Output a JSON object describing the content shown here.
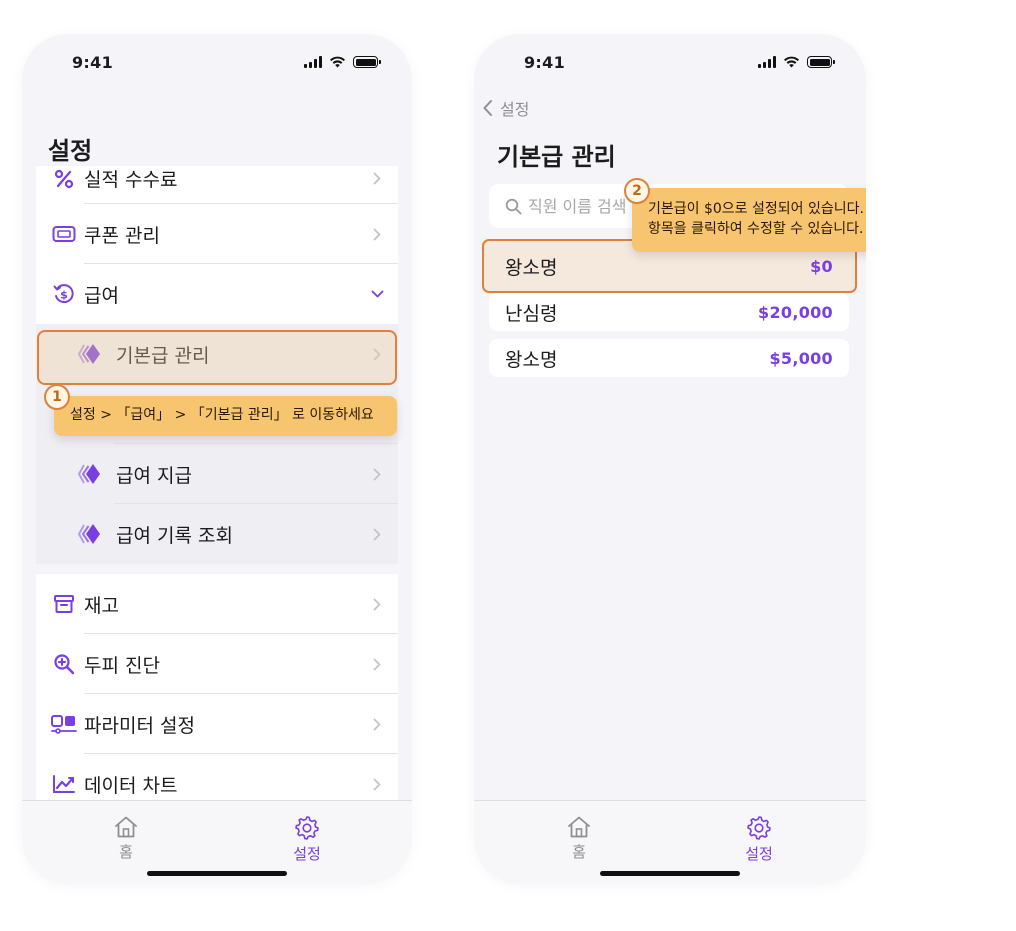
{
  "status_bar": {
    "time": "9:41"
  },
  "screen1": {
    "title": "설정",
    "items_top": [
      {
        "label": "실적 수수료",
        "icon": "percent-icon"
      },
      {
        "label": "쿠폰 관리",
        "icon": "ticket-icon"
      },
      {
        "label": "급여",
        "icon": "payroll-icon",
        "expanded": true
      }
    ],
    "sub_items": [
      {
        "label": "기본급 관리",
        "icon": "diamond-icon"
      },
      {
        "label": "급여 지급",
        "icon": "diamond-icon"
      },
      {
        "label": "급여 기록 조회",
        "icon": "diamond-icon"
      }
    ],
    "items_bottom": [
      {
        "label": "재고",
        "icon": "archive-icon"
      },
      {
        "label": "두피 진단",
        "icon": "zoom-in-icon"
      },
      {
        "label": "파라미터 설정",
        "icon": "parameters-icon"
      },
      {
        "label": "데이터 차트",
        "icon": "line-chart-icon"
      }
    ],
    "step": {
      "number": "1",
      "text": "설정 > 「급여」 > 「기본급 관리」 로 이동하세요"
    }
  },
  "screen2": {
    "back_label": "설정",
    "title": "기본급 관리",
    "search_placeholder": "직원 이름 검색",
    "employees": [
      {
        "name": "왕소명",
        "amount": "$0"
      },
      {
        "name": "난심령",
        "amount": "$20,000"
      },
      {
        "name": "왕소명",
        "amount": "$5,000"
      }
    ],
    "step": {
      "number": "2",
      "line1": "기본급이 $0으로 설정되어 있습니다.",
      "line2": "항목을 클릭하여 수정할 수 있습니다."
    }
  },
  "tab_bar": {
    "home_label": "홈",
    "settings_label": "설정"
  },
  "colors": {
    "accent": "#7a3fe0",
    "highlight_border": "#e0803a",
    "tooltip_bg": "#f7c46f"
  }
}
